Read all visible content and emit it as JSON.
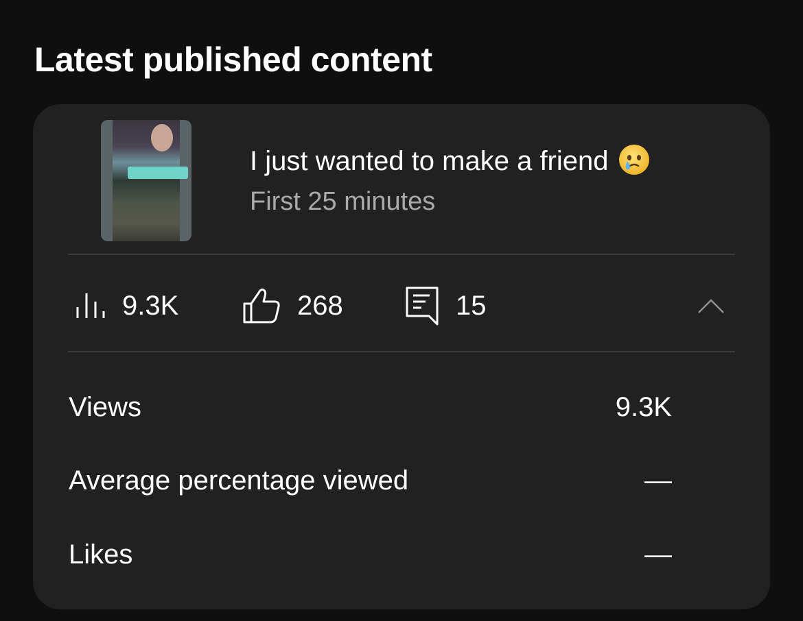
{
  "section": {
    "title": "Latest published content"
  },
  "video": {
    "title": "I just wanted to make a friend",
    "title_emoji": "crying-face-emoji",
    "subtitle": "First 25 minutes"
  },
  "stats": {
    "views": "9.3K",
    "likes": "268",
    "comments": "15"
  },
  "metrics": [
    {
      "label": "Views",
      "value": "9.3K"
    },
    {
      "label": "Average percentage viewed",
      "value": "—"
    },
    {
      "label": "Likes",
      "value": "—"
    }
  ],
  "icons": {
    "views": "bar-chart-icon",
    "likes": "thumbs-up-icon",
    "comments": "comment-icon",
    "collapse": "chevron-up-icon"
  },
  "colors": {
    "background": "#0f0f0f",
    "card": "#212121",
    "text": "#ffffff",
    "secondary_text": "#aaaaaa",
    "divider": "#3a3a3a"
  }
}
